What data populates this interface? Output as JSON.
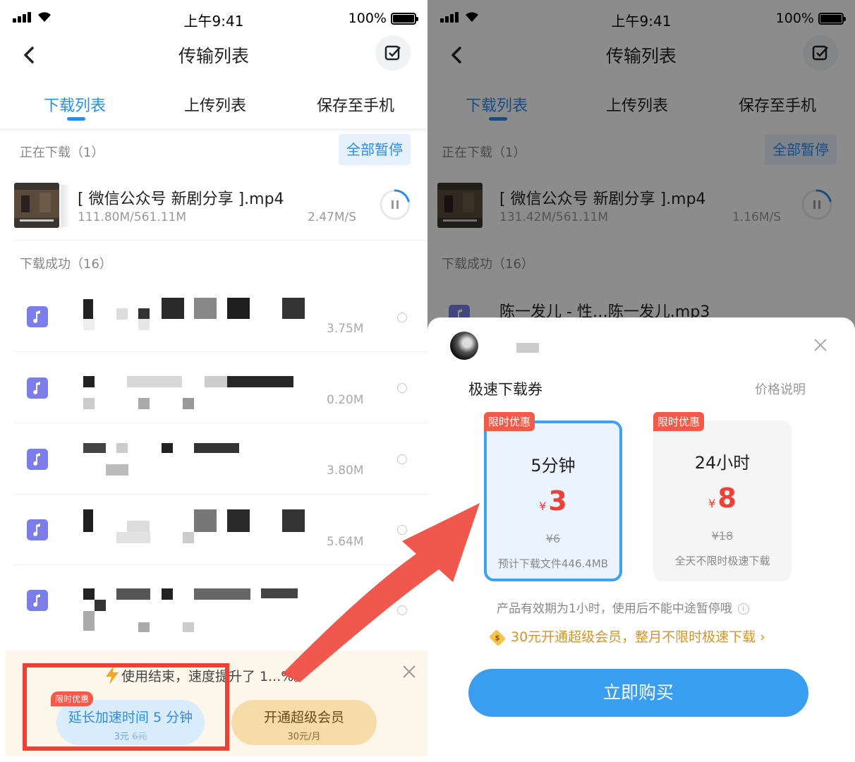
{
  "status": {
    "time": "上午9:41",
    "battery": "100%"
  },
  "nav": {
    "title": "传输列表"
  },
  "tabs": [
    "下载列表",
    "上传列表",
    "保存至手机"
  ],
  "downloading": {
    "header": "正在下载（1）",
    "pause_all": "全部暂停",
    "item": {
      "name": "[ 微信公众号 新剧分享 ].mp4",
      "speed": "2.47M/S",
      "progress": "111.80M/561.11M"
    }
  },
  "completed": {
    "header": "下载成功（16）",
    "items": [
      {
        "size": "3.75M"
      },
      {
        "size": "0.20M"
      },
      {
        "size": "3.80M"
      },
      {
        "size": "5.64M"
      },
      {
        "size": ""
      }
    ]
  },
  "promo": {
    "text": "使用结束，速度提升了 1...%。",
    "extend_label": "延长加速时间 5 分钟",
    "extend_price": "3元",
    "extend_orig": "6元",
    "badge": "限时优惠",
    "vip_label": "开通超级会员",
    "vip_price": "30元/月"
  },
  "right": {
    "downloading_item": {
      "name": "[ 微信公众号 新剧分享 ].mp4",
      "progress": "131.42M/561.11M",
      "speed": "1.16M/S"
    },
    "completed_first": "陈一发儿 - 性…陈一发儿.mp3",
    "sheet": {
      "title": "极速下载券",
      "price_info": "价格说明",
      "options": [
        {
          "badge": "限时优惠",
          "duration": "5分钟",
          "currency": "¥",
          "price": "3",
          "orig": "¥6",
          "note": "预计下载文件446.4MB"
        },
        {
          "badge": "限时优惠",
          "duration": "24小时",
          "currency": "¥",
          "price": "8",
          "orig": "¥18",
          "note": "全天不限时极速下载"
        }
      ],
      "validity": "产品有效期为1小时，使用后不能中途暂停哦",
      "vip_text": "30元开通超级会员，整月不限时极速下载 ›",
      "buy": "立即购买"
    }
  },
  "colors": {
    "accent": "#2b8cf0",
    "price_red": "#ef4035",
    "vip_gold": "#d49528",
    "music_icon": "#7b7ee8"
  }
}
